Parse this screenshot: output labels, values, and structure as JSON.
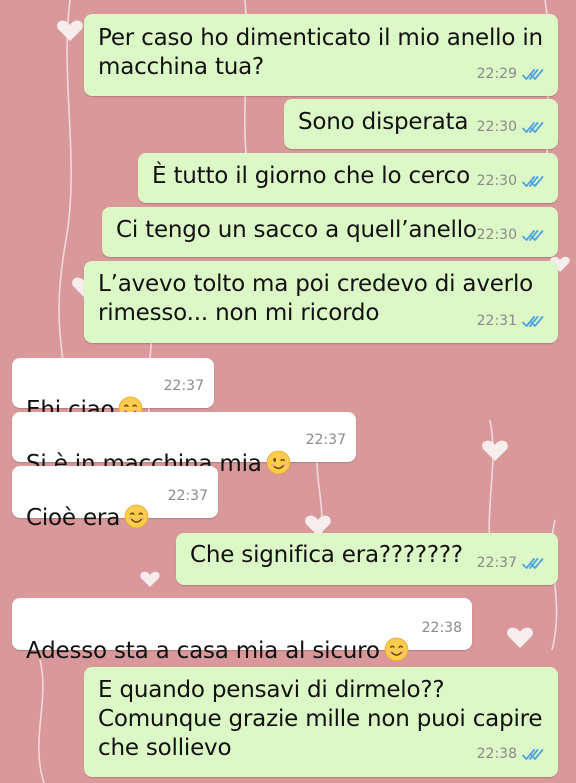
{
  "chat": {
    "messages": [
      {
        "direction": "out",
        "text": "Per caso ho dimenticato il mio anello in\nmacchina tua?",
        "time": "22:29",
        "status": "read"
      },
      {
        "direction": "out",
        "text": "Sono disperata",
        "time": "22:30",
        "status": "read"
      },
      {
        "direction": "out",
        "text": "È tutto il giorno che lo cerco",
        "time": "22:30",
        "status": "read"
      },
      {
        "direction": "out",
        "text": "Ci tengo un sacco a quell’anello",
        "time": "22:30",
        "status": "read"
      },
      {
        "direction": "out",
        "text": "L’avevo tolto ma poi credevo di averlo\nrimesso... non mi ricordo",
        "time": "22:31",
        "status": "read"
      },
      {
        "direction": "in",
        "text": "Ehi ciao",
        "emoji": "smiling-face-icon",
        "time": "22:37"
      },
      {
        "direction": "in",
        "text": "Si è in macchina mia",
        "emoji": "winking-face-icon",
        "time": "22:37"
      },
      {
        "direction": "in",
        "text": "Cioè era",
        "emoji": "smiling-face-icon",
        "time": "22:37"
      },
      {
        "direction": "out",
        "text": "Che significa era???????",
        "time": "22:37",
        "status": "read"
      },
      {
        "direction": "in",
        "text": "Adesso sta a casa mia al sicuro",
        "emoji": "smiling-face-icon",
        "time": "22:38"
      },
      {
        "direction": "out",
        "text": "E quando pensavi di dirmelo??\nComunque grazie mille non puoi capire\nche sollievo",
        "time": "22:38",
        "status": "read"
      }
    ]
  },
  "theme": {
    "wallpaper": "#d9989a",
    "outgoing_bubble": "#dcf8c6",
    "incoming_bubble": "#ffffff",
    "read_ticks": "#4fa3e0",
    "timestamp": "#8a8a8a"
  }
}
